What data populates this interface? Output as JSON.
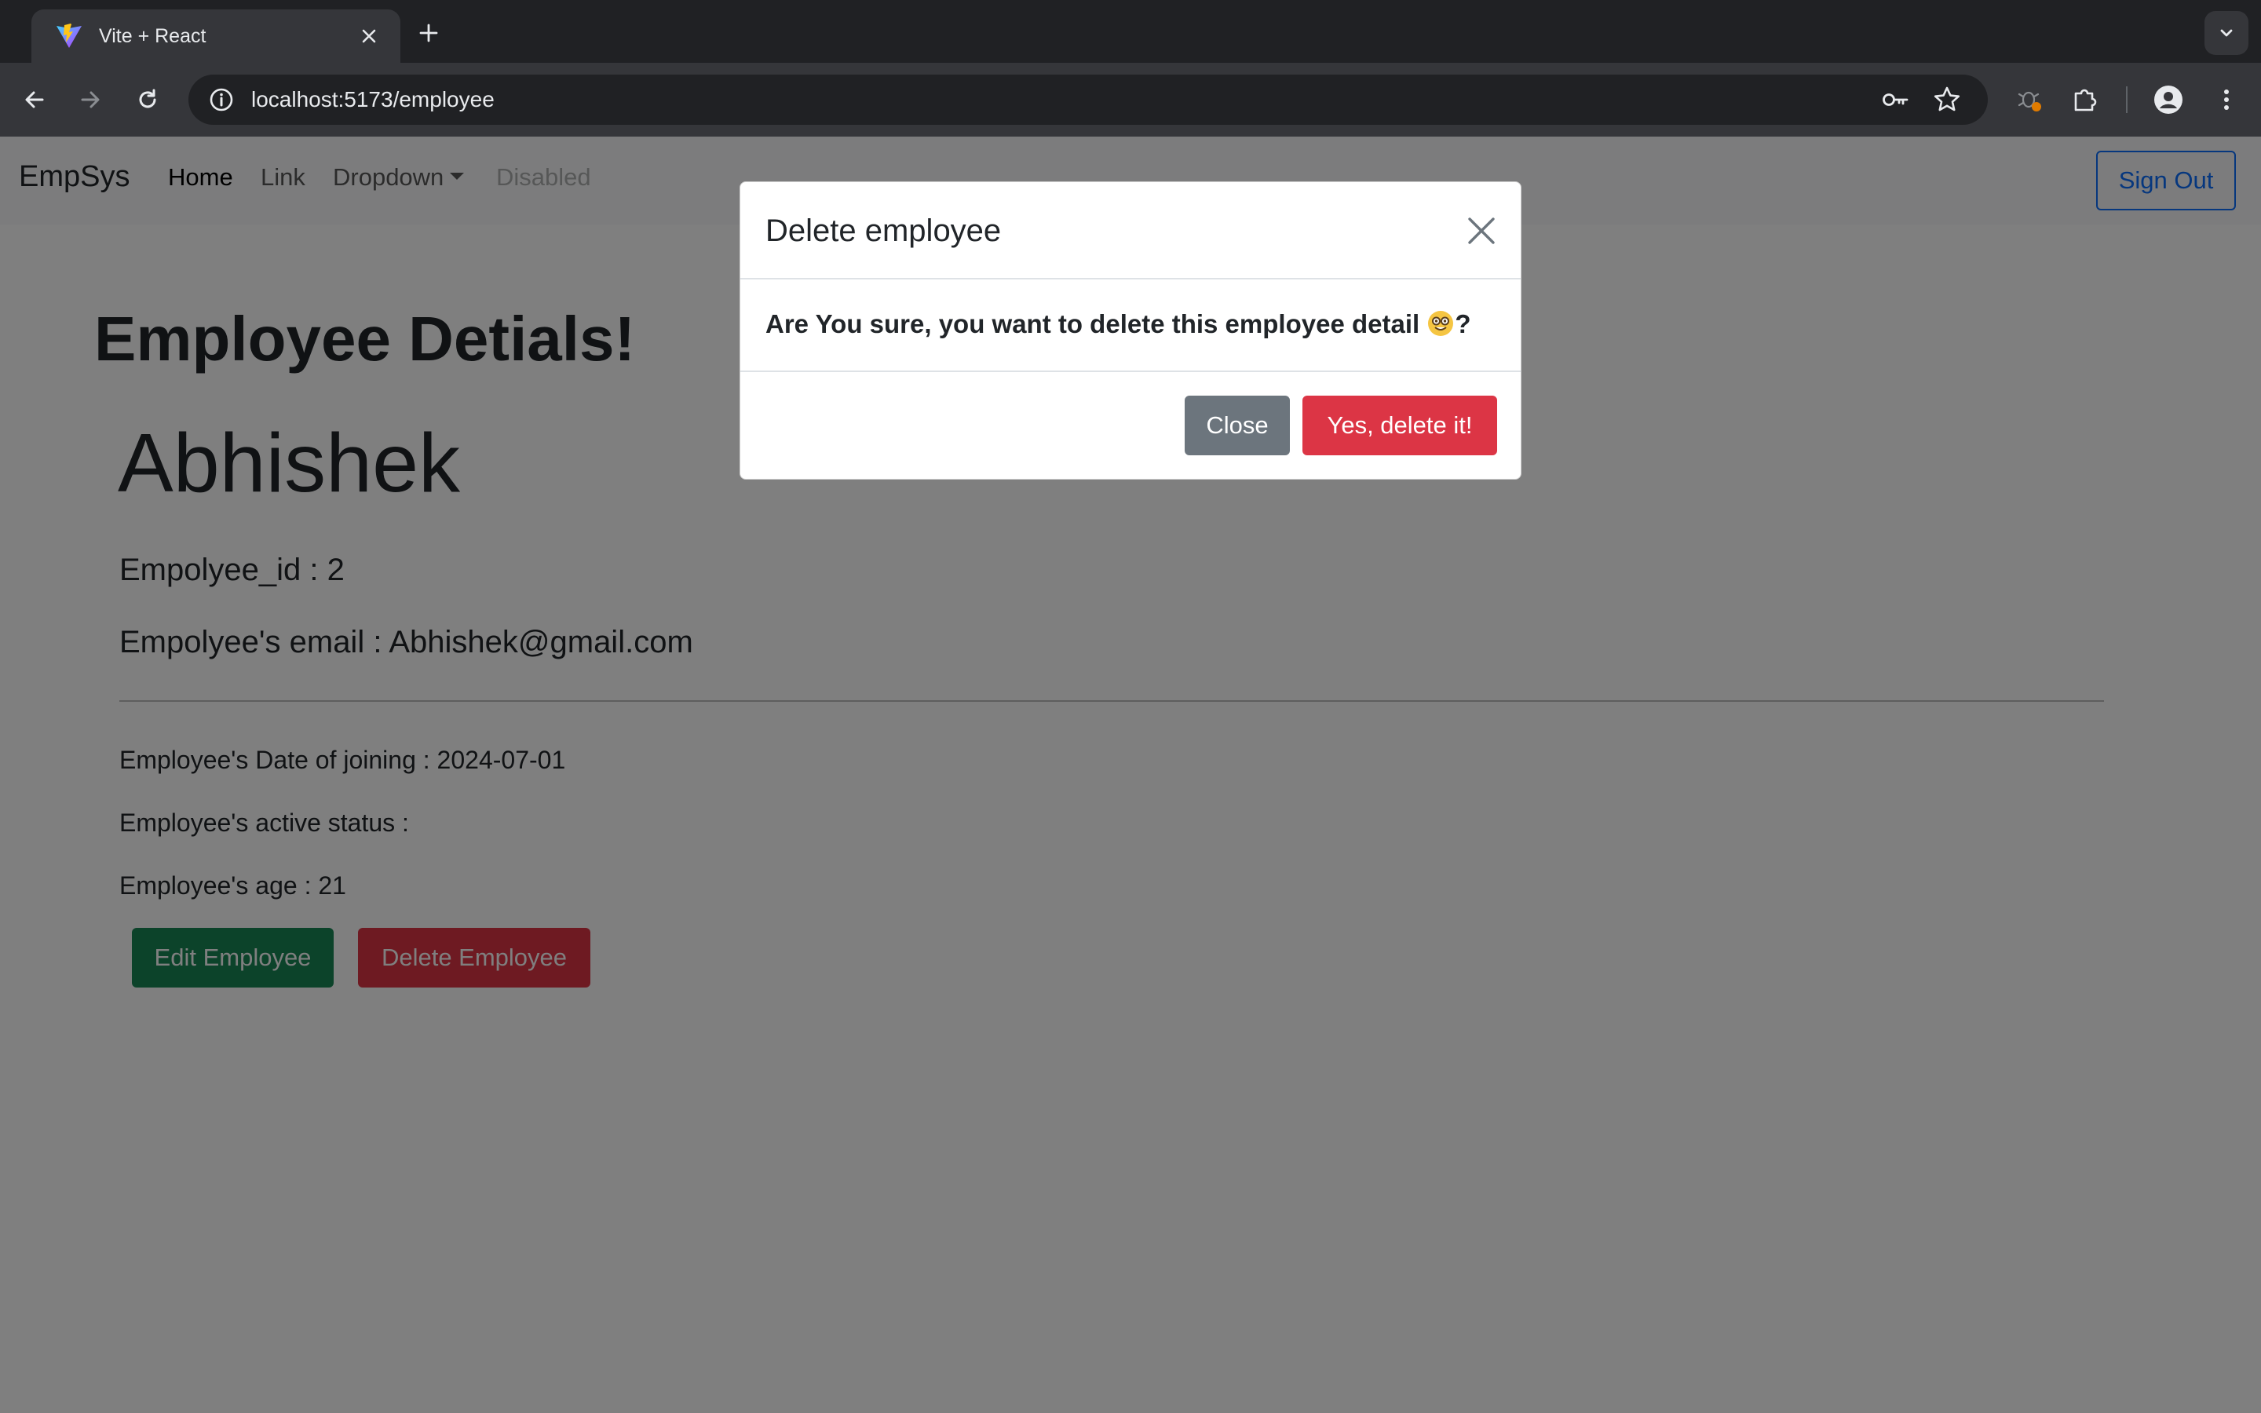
{
  "browser": {
    "tab_title": "Vite + React",
    "url": "localhost:5173/employee"
  },
  "navbar": {
    "brand": "EmpSys",
    "links": [
      {
        "label": "Home",
        "state": "active"
      },
      {
        "label": "Link",
        "state": "normal"
      },
      {
        "label": "Dropdown",
        "state": "normal"
      },
      {
        "label": "Disabled",
        "state": "disabled"
      }
    ],
    "signout_label": "Sign Out"
  },
  "employee": {
    "heading": "Employee Detials!",
    "name": "Abhishek",
    "id_line": "Empolyee_id : 2",
    "email_line": "Empolyee's email : Abhishek@gmail.com",
    "doj_line": "Employee's Date of joining : 2024-07-01",
    "status_line": "Employee's active status :",
    "age_line": "Employee's age : 21",
    "edit_label": "Edit Employee",
    "delete_label": "Delete Employee"
  },
  "modal": {
    "title": "Delete employee",
    "message_before": "Are You sure, you want to delete this employee detail ",
    "message_after": "?",
    "close_label": "Close",
    "confirm_label": "Yes, delete it!"
  },
  "colors": {
    "primary": "#0d6efd",
    "success": "#198754",
    "danger": "#dc3545",
    "secondary": "#6c757d",
    "backdrop": "rgba(0,0,0,0.5)"
  },
  "icons": [
    "vite-favicon",
    "close-icon",
    "plus-icon",
    "chevron-down-icon",
    "back-arrow-icon",
    "forward-arrow-icon",
    "reload-icon",
    "site-info-icon",
    "password-key-icon",
    "bookmark-star-icon",
    "extension-icon",
    "puzzle-icon",
    "profile-icon",
    "more-menu-icon",
    "nerd-face-emoji"
  ]
}
